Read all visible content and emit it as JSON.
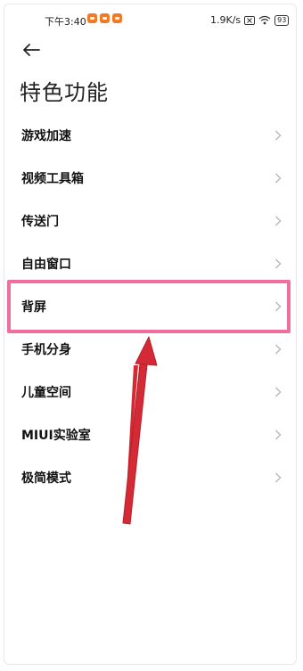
{
  "status_bar": {
    "time": "下午3:40",
    "network_speed": "1.9K/s",
    "battery": "93"
  },
  "header": {
    "title": "特色功能"
  },
  "menu": {
    "items": [
      {
        "label": "游戏加速"
      },
      {
        "label": "视频工具箱"
      },
      {
        "label": "传送门"
      },
      {
        "label": "自由窗口"
      },
      {
        "label": "背屏"
      },
      {
        "label": "手机分身"
      },
      {
        "label": "儿童空间"
      },
      {
        "label": "MIUI实验室"
      },
      {
        "label": "极简模式"
      }
    ]
  },
  "annotations": {
    "highlight_color": "#ef6d9f",
    "arrow_color": "#d42a35"
  }
}
